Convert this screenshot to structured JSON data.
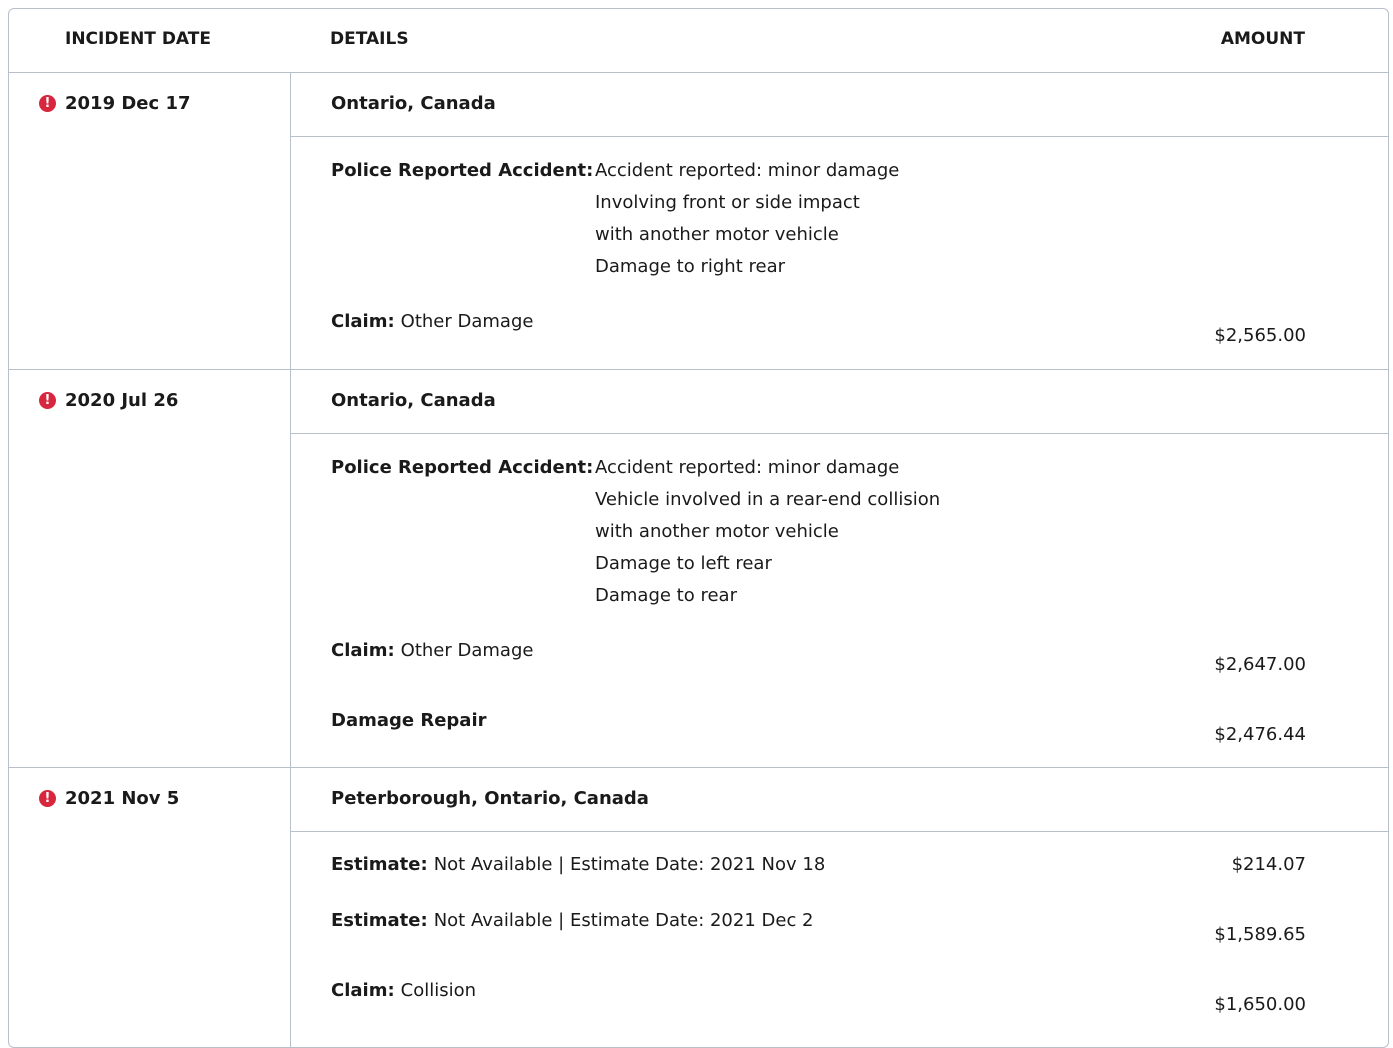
{
  "header": {
    "incident_date": "INCIDENT DATE",
    "details": "DETAILS",
    "amount": "AMOUNT"
  },
  "icons": {
    "alert": "exclamation-circle-icon"
  },
  "colors": {
    "alert": "#d7263d",
    "border": "#b8c0cc"
  },
  "incidents": [
    {
      "date": "2019 Dec 17",
      "location": "Ontario, Canada",
      "police_label": "Police Reported Accident:",
      "police_lines": [
        "Accident reported: minor damage",
        "Involving front or side impact",
        "with another motor vehicle",
        "Damage to right rear"
      ],
      "claim_label": "Claim:",
      "claim_value": "Other Damage",
      "claim_amount": "$2,565.00"
    },
    {
      "date": "2020 Jul 26",
      "location": "Ontario, Canada",
      "police_label": "Police Reported Accident:",
      "police_lines": [
        "Accident reported: minor damage",
        "Vehicle involved in a rear-end collision",
        "with another motor vehicle",
        "Damage to left rear",
        "Damage to rear"
      ],
      "claim_label": "Claim:",
      "claim_value": "Other Damage",
      "claim_amount": "$2,647.00",
      "repair_label": "Damage Repair",
      "repair_amount": "$2,476.44"
    },
    {
      "date": "2021 Nov 5",
      "location": "Peterborough, Ontario, Canada",
      "estimate1_label": "Estimate:",
      "estimate1_value": "Not Available | Estimate Date: 2021 Nov 18",
      "estimate1_amount": "$214.07",
      "estimate2_label": "Estimate:",
      "estimate2_value": "Not Available | Estimate Date: 2021 Dec 2",
      "estimate2_amount": "$1,589.65",
      "claim_label": "Claim:",
      "claim_value": "Collision",
      "claim_amount": "$1,650.00"
    }
  ]
}
